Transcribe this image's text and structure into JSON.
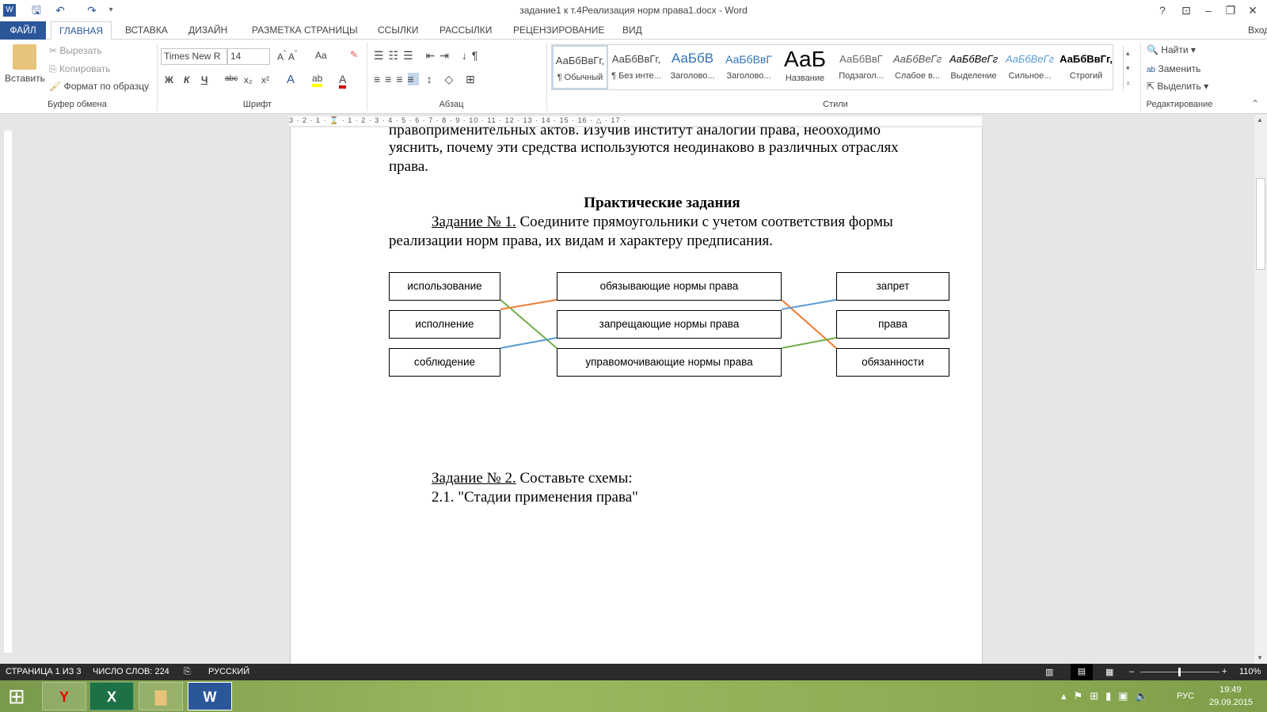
{
  "window": {
    "title": "задание1  к т.4Реализация норм права1.docx - Word",
    "help": "?",
    "signin": "Вход"
  },
  "tabs": [
    "ФАЙЛ",
    "ГЛАВНАЯ",
    "ВСТАВКА",
    "ДИЗАЙН",
    "РАЗМЕТКА СТРАНИЦЫ",
    "ССЫЛКИ",
    "РАССЫЛКИ",
    "РЕЦЕНЗИРОВАНИЕ",
    "ВИД"
  ],
  "ribbon": {
    "clipboard": {
      "paste": "Вставить",
      "cut": "Вырезать",
      "copy": "Копировать",
      "format_painter": "Формат по образцу",
      "label": "Буфер обмена"
    },
    "font": {
      "name": "Times New R",
      "size": "14",
      "label": "Шрифт",
      "bold": "Ж",
      "italic": "К",
      "underline": "Ч",
      "strike": "abc",
      "sub": "x₂",
      "sup": "x²",
      "case": "Aa"
    },
    "paragraph": {
      "label": "Абзац"
    },
    "styles": {
      "label": "Стили",
      "items": [
        {
          "preview": "АаБбВвГг,",
          "name": "¶ Обычный"
        },
        {
          "preview": "АаБбВвГг,",
          "name": "¶ Без инте..."
        },
        {
          "preview": "АаБбВ",
          "name": "Заголово..."
        },
        {
          "preview": "АаБбВвГ",
          "name": "Заголово..."
        },
        {
          "preview": "АаБ",
          "name": "Название"
        },
        {
          "preview": "АаБбВвГ",
          "name": "Подзагол..."
        },
        {
          "preview": "АаБбВеГг",
          "name": "Слабое в..."
        },
        {
          "preview": "АаБбВеГг",
          "name": "Выделение"
        },
        {
          "preview": "АаБбВеГг",
          "name": "Сильное..."
        },
        {
          "preview": "АаБбВвГг,",
          "name": "Строгий"
        }
      ]
    },
    "editing": {
      "find": "Найти",
      "replace": "Заменить",
      "select": "Выделить",
      "label": "Редактирование"
    }
  },
  "ruler": "3 · 2 · 1 · ⌛ · 1 · 2 · 3 · 4 · 5 · 6 · 7 · 8 · 9 · 10 · 11 · 12 · 13 · 14 · 15 · 16 · △ · 17 ·",
  "document": {
    "line_cut": "правоприменительных  актов.  Изучив  институт  аналогии  права,  необходимо",
    "line2": "уяснить, почему эти средства используются неодинаково в различных отраслях",
    "line3": "права.",
    "heading": "Практические задания",
    "task1_label": "Задание № 1.",
    "task1_text": " Соедините прямоугольники с учетом соответствия формы",
    "task1_text2": "реализации норм права, их видам и характеру предписания.",
    "col_forms": [
      "использование",
      "исполнение",
      "соблюдение"
    ],
    "col_norms": [
      "обязывающие нормы права",
      "запрещающие нормы права",
      "управомочивающие нормы права"
    ],
    "col_character": [
      "запрет",
      "права",
      "обязанности"
    ],
    "line_colors": {
      "orange": "#ed7d31",
      "green": "#70ad47",
      "blue": "#5b9bd5"
    },
    "task2_label": "Задание № 2.",
    "task2_text": " Составьте схемы:",
    "task2_1": "2.1. \"Стадии применения права\""
  },
  "status": {
    "page": "СТРАНИЦА 1 ИЗ 3",
    "words": "ЧИСЛО СЛОВ: 224",
    "language": "РУССКИЙ",
    "zoom": "110%",
    "zoom_level": 110
  },
  "taskbar": {
    "lang": "РУС",
    "time": "19:49",
    "date": "29.09.2015"
  }
}
